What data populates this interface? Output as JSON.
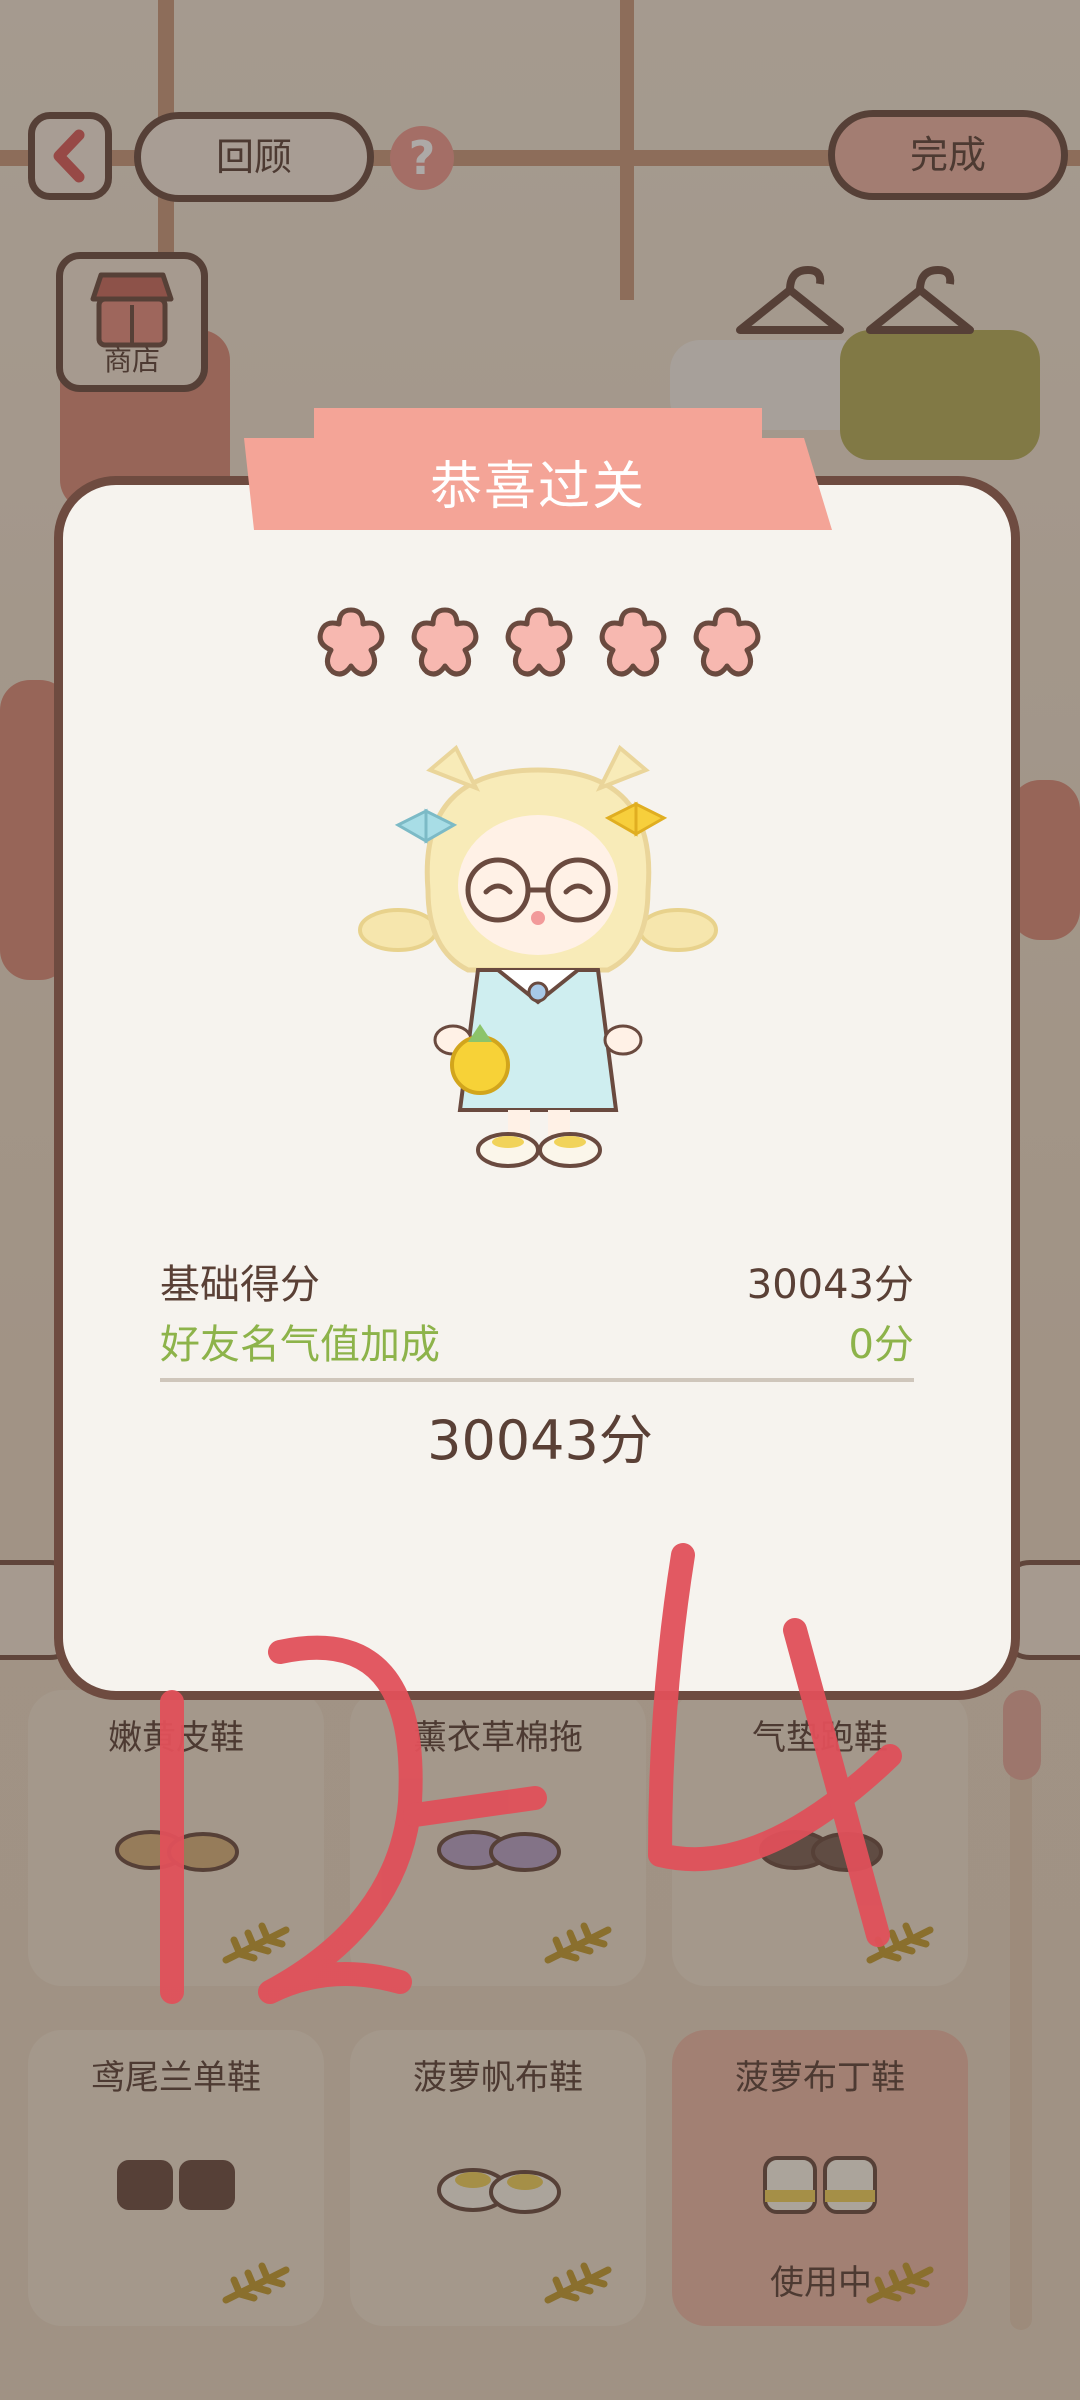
{
  "top_bar": {
    "back_icon": "chevron-left-icon",
    "review_label": "回顾",
    "help_icon": "question-icon",
    "done_label": "完成"
  },
  "shop": {
    "label": "商店",
    "icon": "shop-awning-icon"
  },
  "result": {
    "title": "恭喜过关",
    "stars_earned": 5,
    "stars_total": 5,
    "base_score_label": "基础得分",
    "base_score_value": "30043分",
    "bonus_label": "好友名气值加成",
    "bonus_value": "0分",
    "total_value": "30043分"
  },
  "items": [
    {
      "name": "嫩黄皮鞋",
      "cost_icon": "wheat-icon",
      "shoe_color": "#d7b27a",
      "status": ""
    },
    {
      "name": "薰衣草棉拖",
      "cost_icon": "wheat-icon",
      "shoe_color": "#b7a2c9",
      "status": ""
    },
    {
      "name": "气垫跑鞋",
      "cost_icon": "wheat-icon",
      "shoe_color": "#7a6054",
      "status": ""
    },
    {
      "name": "鸢尾兰单鞋",
      "cost_icon": "wheat-icon",
      "shoe_color": "#6a4a3f",
      "status": ""
    },
    {
      "name": "菠萝帆布鞋",
      "cost_icon": "wheat-icon",
      "shoe_color": "#f1d35a",
      "status": ""
    },
    {
      "name": "菠萝布丁鞋",
      "cost_icon": "wheat-icon",
      "shoe_color": "#f1d35a",
      "status": "使用中"
    }
  ],
  "annotation": "12-4",
  "colors": {
    "accent": "#f2a093",
    "outline": "#6e4b40",
    "bonus_green": "#8db34a",
    "annotation_red": "#e0505a"
  }
}
